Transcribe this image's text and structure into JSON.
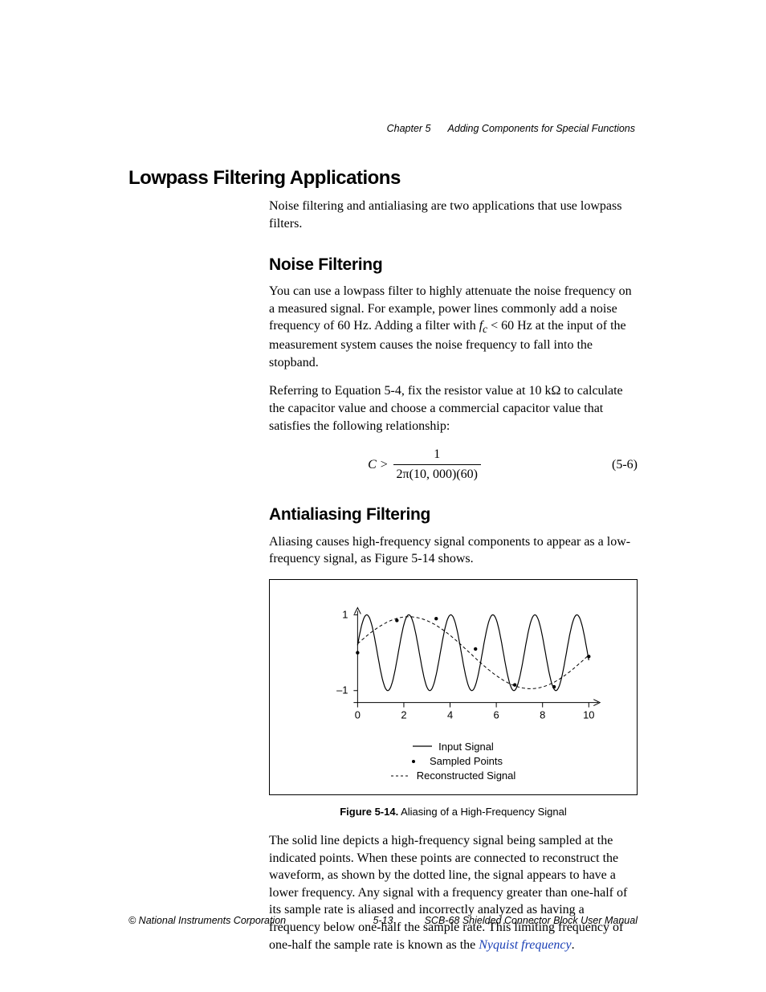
{
  "header": {
    "chapter": "Chapter 5",
    "title": "Adding Components for Special Functions"
  },
  "section": {
    "title": "Lowpass Filtering Applications",
    "intro": "Noise filtering and antialiasing are two applications that use lowpass filters."
  },
  "noise": {
    "title": "Noise Filtering",
    "p1_a": "You can use a lowpass filter to highly attenuate the noise frequency on a measured signal. For example, power lines commonly add a noise frequency of 60 Hz. Adding a filter with ",
    "p1_fc": "f",
    "p1_fc_sub": "c",
    "p1_b": " < 60 Hz at the input of the measurement system causes the noise frequency to fall into the stopband.",
    "p2": "Referring to Equation 5-4, fix the resistor value at 10 kΩ to calculate the capacitor value and choose a commercial capacitor value that satisfies the following relationship:",
    "eq_left": "C >",
    "eq_num_top": "1",
    "eq_num_bot": "2π(10, 000)(60)",
    "eq_number": "(5-6)"
  },
  "anti": {
    "title": "Antialiasing Filtering",
    "p1": "Aliasing causes high-frequency signal components to appear as a low-frequency signal, as Figure 5-14 shows.",
    "caption_bold": "Figure 5-14.",
    "caption_rest": "  Aliasing of a High-Frequency Signal",
    "p2_a": "The solid line depicts a high-frequency signal being sampled at the indicated points. When these points are connected to reconstruct the waveform, as shown by the dotted line, the signal appears to have a lower frequency. Any signal with a frequency greater than one-half of its sample rate is aliased and incorrectly analyzed as having a frequency below one-half the sample rate. This limiting frequency of one-half the sample rate is known as the ",
    "p2_link": "Nyquist frequency",
    "p2_b": "."
  },
  "legend": {
    "l1": "Input Signal",
    "l2": "Sampled Points",
    "l3": "Reconstructed Signal"
  },
  "chart_data": {
    "type": "line",
    "title": "Aliasing of a High-Frequency Signal",
    "xlabel": "",
    "ylabel": "",
    "xlim": [
      0,
      10
    ],
    "ylim": [
      -1,
      1
    ],
    "x_ticks": [
      0,
      2,
      4,
      6,
      8,
      10
    ],
    "y_ticks": [
      -1,
      1
    ],
    "series": [
      {
        "name": "Input Signal",
        "style": "solid",
        "note": "~5.5 cycles over x=0..10, amplitude 1"
      },
      {
        "name": "Reconstructed Signal",
        "style": "dashed",
        "note": "~1 cycle over x=0..10, amplitude ~0.95"
      }
    ],
    "sampled_points": [
      {
        "x": 0.0,
        "y": 0.0
      },
      {
        "x": 1.7,
        "y": 0.85
      },
      {
        "x": 3.4,
        "y": 0.9
      },
      {
        "x": 5.1,
        "y": 0.1
      },
      {
        "x": 6.8,
        "y": -0.85
      },
      {
        "x": 8.5,
        "y": -0.9
      },
      {
        "x": 10.0,
        "y": -0.1
      }
    ]
  },
  "axis_labels": {
    "y_top": "1",
    "y_bot": "–1",
    "x0": "0",
    "x2": "2",
    "x4": "4",
    "x6": "6",
    "x8": "8",
    "x10": "10"
  },
  "footer": {
    "left": "© National Instruments Corporation",
    "center": "5-13",
    "right": "SCB-68 Shielded Connector Block User Manual"
  }
}
